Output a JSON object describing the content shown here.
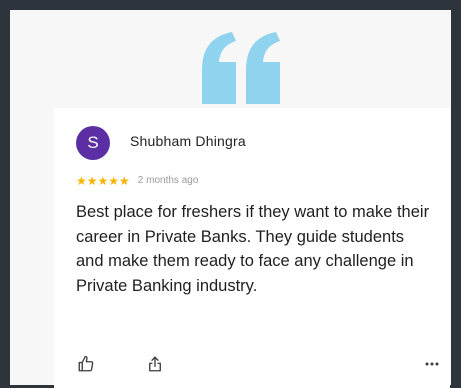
{
  "review": {
    "avatar_letter": "S",
    "author": "Shubham Dhingra",
    "stars": "★★★★★",
    "rating": 5,
    "time_ago": "2 months ago",
    "text": "Best place for freshers if they want to make their career in Private Banks. They guide students and make them ready to face any challenge in Private Banking industry."
  },
  "icons": {
    "quote": "quote-icon",
    "like": "thumbs-up-icon",
    "share": "share-icon",
    "more": "more-horizontal-icon"
  },
  "colors": {
    "frame": "#2e343b",
    "card": "#f7f7f7",
    "quote": "#8fd3ef",
    "avatar": "#5b2fa3",
    "stars": "#f5b400"
  }
}
